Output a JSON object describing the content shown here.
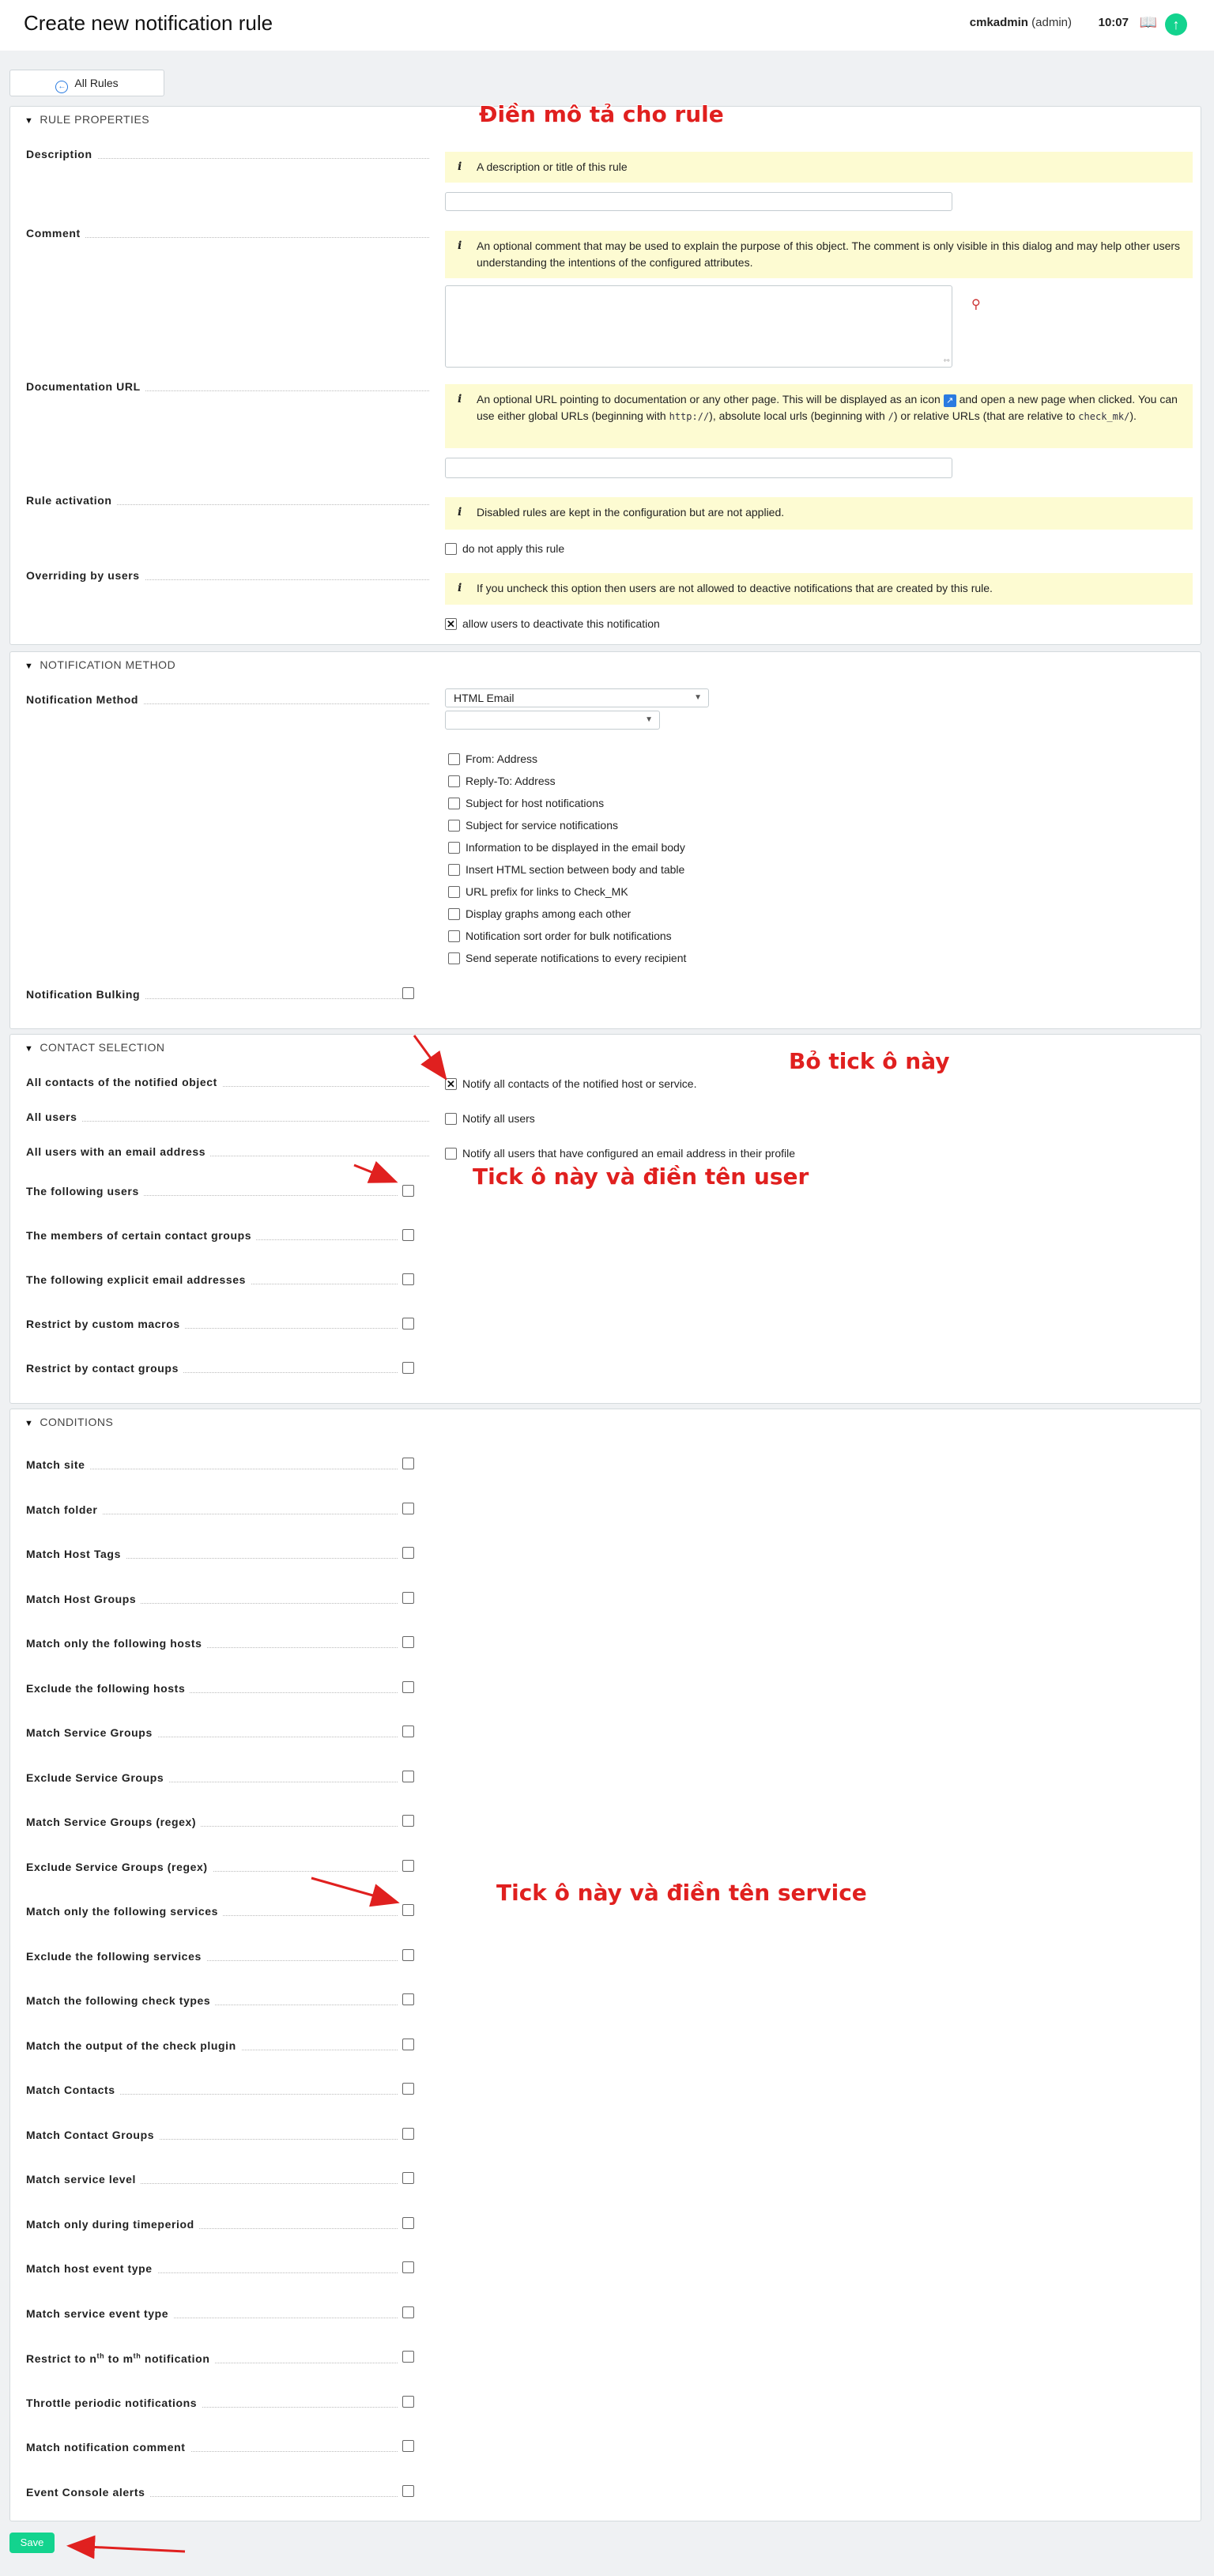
{
  "header": {
    "title": "Create new notification rule",
    "username": "cmkadmin",
    "role": "(admin)",
    "time": "10:07"
  },
  "toolbar": {
    "all_rules_label": "All Rules"
  },
  "rule_properties": {
    "heading": "RULE PROPERTIES",
    "description": {
      "label": "Description",
      "help": "A description or title of this rule",
      "value": ""
    },
    "comment": {
      "label": "Comment",
      "help": "An optional comment that may be used to explain the purpose of this object. The comment is only visible in this dialog and may help other users understanding the intentions of the configured attributes.",
      "value": ""
    },
    "documentation_url": {
      "label": "Documentation URL",
      "help_part1": "An optional URL pointing to documentation or any other page. This will be displayed as an icon",
      "help_part2": "and open a new page when clicked. You can use either global URLs (beginning with",
      "code1": "http://",
      "help_part3": "), absolute local urls (beginning with",
      "code2": "/",
      "help_part4": ") or relative URLs (that are relative to",
      "code3": "check_mk/",
      "help_part5": ").",
      "value": ""
    },
    "rule_activation": {
      "label": "Rule activation",
      "help": "Disabled rules are kept in the configuration but are not applied.",
      "checkbox_label": "do not apply this rule",
      "checked": false
    },
    "overriding": {
      "label": "Overriding by users",
      "help": "If you uncheck this option then users are not allowed to deactive notifications that are created by this rule.",
      "checkbox_label": "allow users to deactivate this notification",
      "checked": true
    }
  },
  "notification_method": {
    "heading": "NOTIFICATION METHOD",
    "method_label": "Notification Method",
    "method_value": "HTML Email",
    "secondary_value": "",
    "options": [
      "From: Address",
      "Reply-To: Address",
      "Subject for host notifications",
      "Subject for service notifications",
      "Information to be displayed in the email body",
      "Insert HTML section between body and table",
      "URL prefix for links to Check_MK",
      "Display graphs among each other",
      "Notification sort order for bulk notifications",
      "Send seperate notifications to every recipient"
    ],
    "bulking_label": "Notification Bulking"
  },
  "contact_selection": {
    "heading": "CONTACT SELECTION",
    "rows": [
      {
        "label": "All contacts of the notified object",
        "checkbox_label": "Notify all contacts of the notified host or service.",
        "checked": true
      },
      {
        "label": "All users",
        "checkbox_label": "Notify all users",
        "checked": false
      },
      {
        "label": "All users with an email address",
        "checkbox_label": "Notify all users that have configured an email address in their profile",
        "checked": false
      },
      {
        "label": "The following users"
      },
      {
        "label": "The members of certain contact groups"
      },
      {
        "label": "The following explicit email addresses"
      },
      {
        "label": "Restrict by custom macros"
      },
      {
        "label": "Restrict by contact groups"
      }
    ]
  },
  "conditions": {
    "heading": "CONDITIONS",
    "rows": [
      "Match site",
      "Match folder",
      "Match Host Tags",
      "Match Host Groups",
      "Match only the following hosts",
      "Exclude the following hosts",
      "Match Service Groups",
      "Exclude Service Groups",
      "Match Service Groups (regex)",
      "Exclude Service Groups (regex)",
      "Match only the following services",
      "Exclude the following services",
      "Match the following check types",
      "Match the output of the check plugin",
      "Match Contacts",
      "Match Contact Groups",
      "Match service level",
      "Match only during timeperiod",
      "Match host event type",
      "Match service event type",
      "Restrict to nth to mth notification",
      "Throttle periodic notifications",
      "Match notification comment",
      "Event Console alerts"
    ],
    "restrict_parts": {
      "a": "Restrict to n",
      "b": "th",
      "c": " to m",
      "d": "th",
      "e": " notification"
    }
  },
  "save_label": "Save",
  "annotations": {
    "describe_rule": "Điền mô tả cho rule",
    "untick_box": "Bỏ tick ô này",
    "tick_user": "Tick ô này và điền tên user",
    "tick_service": "Tick ô này và điền tên service"
  },
  "colors": {
    "accent": "#13d38e",
    "help_bg": "#fdfbd2",
    "annotation": "#e0201f"
  }
}
